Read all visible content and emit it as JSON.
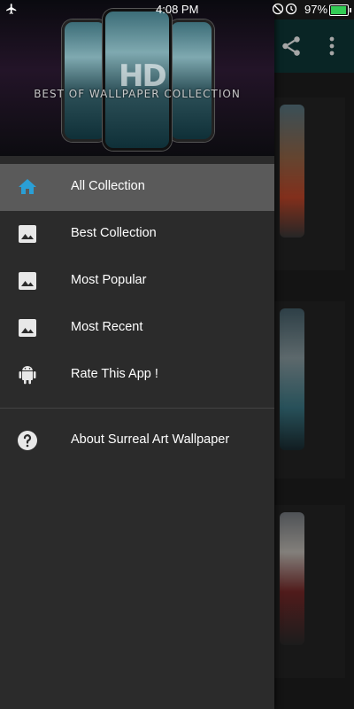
{
  "status_bar": {
    "time": "4:08 PM",
    "battery_text": "97%",
    "battery_level": 0.97,
    "icons": [
      "airplane-icon",
      "no-sim-icon",
      "alarm-icon",
      "battery-icon"
    ]
  },
  "header": {
    "banner_text": "BEST OF WALLPAPER COLLECTION",
    "logo_text": "HD"
  },
  "drawer": {
    "items": [
      {
        "label": "All Collection",
        "icon": "home-icon",
        "active": true
      },
      {
        "label": "Best Collection",
        "icon": "image-icon"
      },
      {
        "label": "Most Popular",
        "icon": "image-icon"
      },
      {
        "label": "Most Recent",
        "icon": "image-icon"
      },
      {
        "label": "Rate This App !",
        "icon": "android-icon"
      }
    ],
    "about": {
      "label": "About Surreal Art Wallpaper",
      "icon": "help-circle-icon"
    }
  },
  "toolbar": {
    "icons": [
      "share-icon",
      "more-vert-icon"
    ]
  },
  "colors": {
    "active_item_bg": "#5a5a5a",
    "home_icon": "#2a9fd6",
    "drawer_bg": "#2b2b2b",
    "toolbar_bg": "#0f3a3a"
  }
}
